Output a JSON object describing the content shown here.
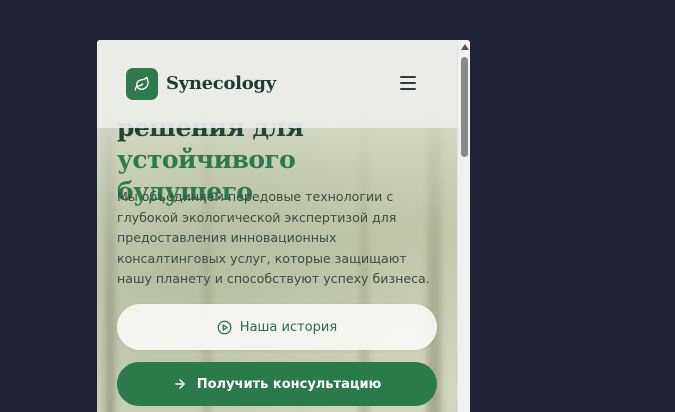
{
  "brand": {
    "name": "Synecology",
    "logo_icon": "leaf-icon",
    "accent": "#2f7a4b"
  },
  "header": {
    "menu_icon": "hamburger-menu-icon"
  },
  "hero": {
    "title_line1": "решения для",
    "title_line2": "устойчивого будущего",
    "description": "Мы объединяем передовые технологии с глубокой экологической экспертизой для предоставления инновационных консалтинговых услуг, которые защищают нашу планету и способствуют успеху бизнеса."
  },
  "buttons": {
    "story_label": "Наша история",
    "story_icon": "play-circle-icon",
    "consult_label": "Получить консультацию",
    "consult_icon": "arrow-right-icon"
  },
  "colors": {
    "page_bg": "#1f2333",
    "button_primary": "#2a7a4b",
    "title_dark": "#234238",
    "title_green": "#2d7a4d"
  }
}
